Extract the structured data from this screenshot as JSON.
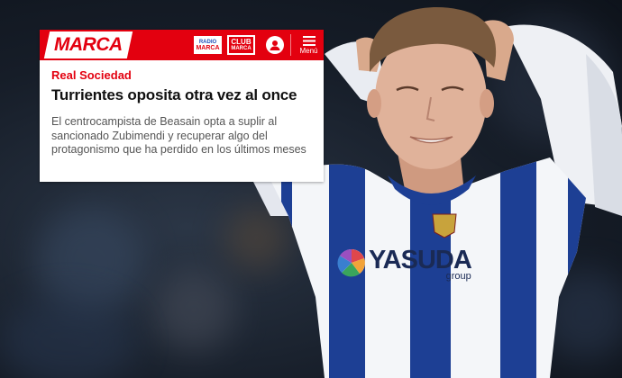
{
  "brand": {
    "logo": "MARCA",
    "red": "#e3000f",
    "blue": "#1f4fb8"
  },
  "header": {
    "radio_badge": {
      "top": "RADIO",
      "bottom": "MARCA"
    },
    "club_badge": {
      "top": "CLUB",
      "bottom": "MARCA"
    },
    "user_icon": "user-icon",
    "menu_icon": "menu-icon",
    "menu_label": "Menú"
  },
  "article": {
    "section": "Real Sociedad",
    "headline": "Turrientes oposita otra vez al once",
    "summary": "El centrocampista de Beasain opta a suplir al sancionado Zubimendi y recuperar algo del protagonismo que ha perdido en los últimos meses"
  },
  "photo": {
    "subject": "player-photo",
    "shirt_sponsor": "YASUDA",
    "shirt_sponsor_sub": "group"
  }
}
